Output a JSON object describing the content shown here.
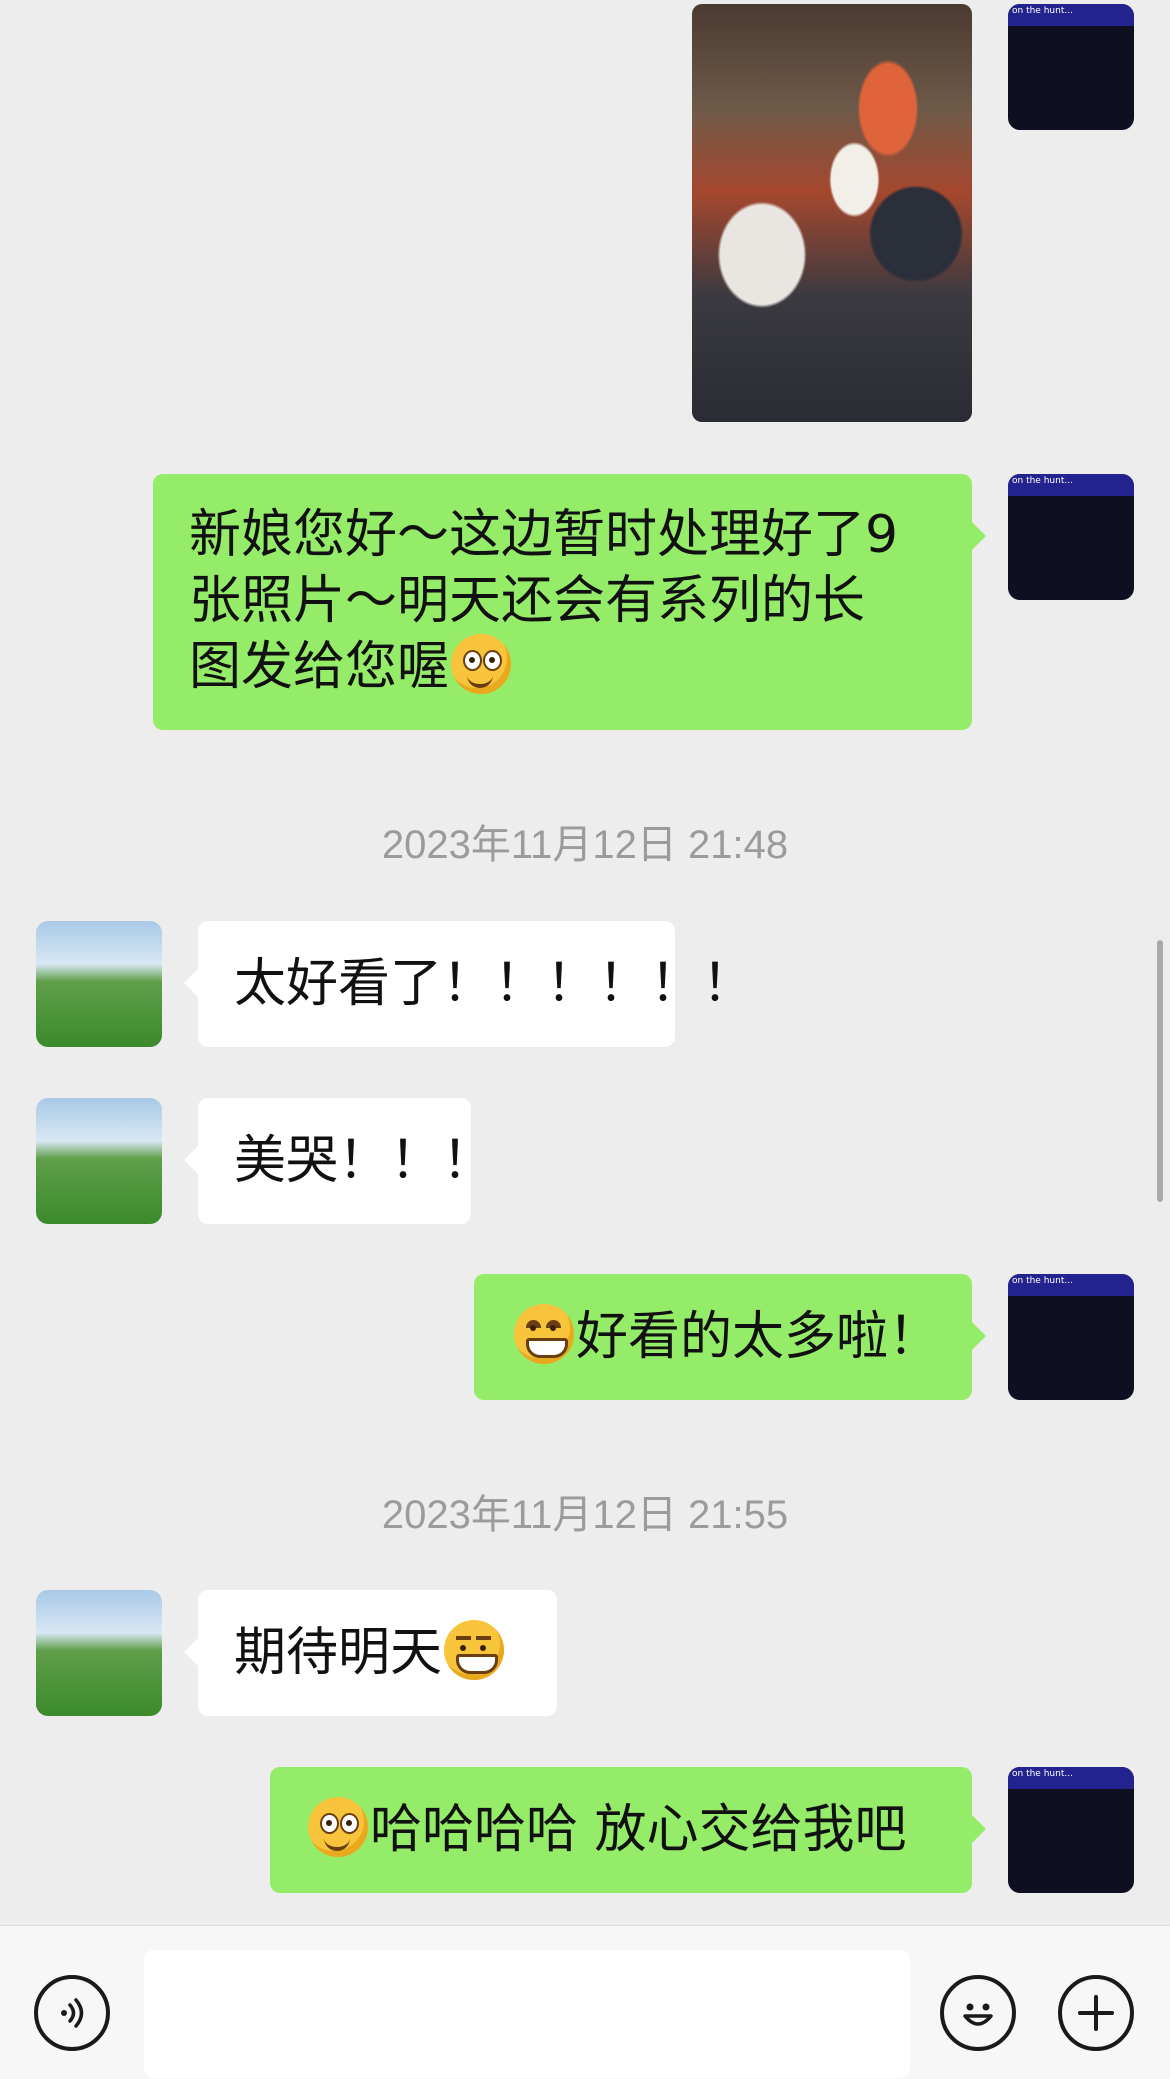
{
  "chat": {
    "timestamps": [
      "2023年11月12日 21:48",
      "2023年11月12日 21:55"
    ],
    "self_avatar_caption": "on the hunt...",
    "messages": [
      {
        "from": "self",
        "type": "image"
      },
      {
        "from": "self",
        "type": "text",
        "lines": [
          "新娘您好～这边暂时处理好了9",
          "张照片～明天还会有系列的长",
          "图发给您喔"
        ],
        "emoji": "thinking-face"
      },
      {
        "from": "other",
        "type": "text",
        "text": "太好看了！！！！！！"
      },
      {
        "from": "other",
        "type": "text",
        "text": "美哭！！！"
      },
      {
        "from": "self",
        "type": "text",
        "text": "好看的太多啦！",
        "emoji": "grinning-face"
      },
      {
        "from": "other",
        "type": "text",
        "text": "期待明天",
        "emoji": "grimacing-grin"
      },
      {
        "from": "self",
        "type": "text",
        "text": "哈哈哈哈 放心交给我吧",
        "emoji": "thinking-face"
      }
    ]
  },
  "input_bar": {
    "voice_icon": "voice-icon",
    "emoji_icon": "emoji-icon",
    "plus_icon": "plus-icon",
    "input_value": ""
  },
  "colors": {
    "background": "#ededed",
    "outgoing_bubble": "#95ec69",
    "incoming_bubble": "#ffffff",
    "timestamp_text": "#9b9b9b"
  }
}
